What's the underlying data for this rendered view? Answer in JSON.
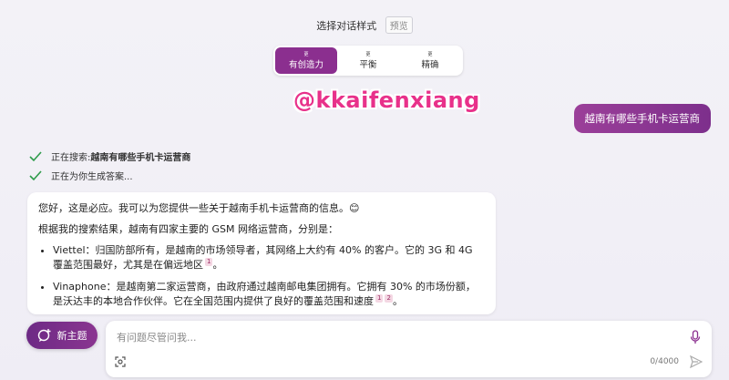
{
  "header": {
    "title": "选择对话样式",
    "preview": "预览"
  },
  "tone": {
    "buttons": [
      {
        "sup": "更",
        "label": "有创造力"
      },
      {
        "sup": "更",
        "label": "平衡"
      },
      {
        "sup": "更",
        "label": "精确"
      }
    ],
    "selected": "有创造力"
  },
  "watermark": "@kkaifenxiang",
  "user_message": "越南有哪些手机卡运营商",
  "status": {
    "searching_prefix": "正在搜索: ",
    "searching_query": "越南有哪些手机卡运营商",
    "generating": "正在为你生成答案..."
  },
  "answer": {
    "greeting": "您好，这是必应。我可以为您提供一些关于越南手机卡运营商的信息。😊",
    "intro": "根据我的搜索结果，越南有四家主要的 GSM 网络运营商，分别是：",
    "items": [
      {
        "text": "Viettel：归国防部所有，是越南的市场领导者，其网络上大约有 40% 的客户。它的 3G 和 4G 覆盖范围最好，尤其是在偏远地区",
        "refs": [
          "1"
        ]
      },
      {
        "text": "Vinaphone：是越南第二家运营商，由政府通过越南邮电集团拥有。它拥有 30% 的市场份额，是沃达丰的本地合作伙伴。它在全国范围内提供了良好的覆盖范围和速度",
        "refs": [
          "1",
          "2"
        ]
      }
    ]
  },
  "new_topic": "新主题",
  "input": {
    "placeholder": "有问题尽管问我...",
    "counter": "0/4000"
  },
  "colors": {
    "accent": "#8b2f8f",
    "check": "#2e9b4a"
  }
}
